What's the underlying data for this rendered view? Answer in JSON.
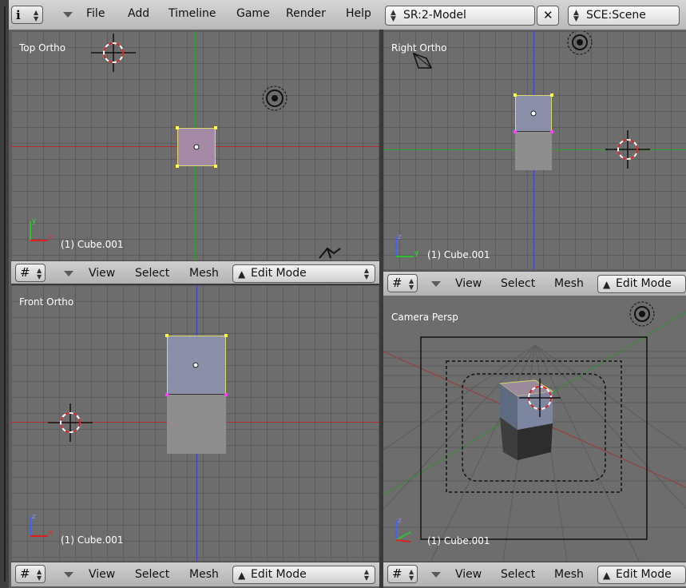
{
  "menubar": {
    "items": [
      "File",
      "Add",
      "Timeline",
      "Game",
      "Render",
      "Help"
    ],
    "screen_field": "SR:2-Model",
    "scene_field": "SCE:Scene",
    "close_glyph": "✕",
    "info_glyph": "i"
  },
  "viewports": {
    "top": {
      "label": "Top Ortho",
      "object": "(1) Cube.001"
    },
    "right": {
      "label": "Right Ortho",
      "object": "(1) Cube.001"
    },
    "front": {
      "label": "Front Ortho",
      "object": "(1) Cube.001"
    },
    "camera": {
      "label": "Camera Persp",
      "object": "(1) Cube.001"
    }
  },
  "viewport_header": {
    "view": "View",
    "select": "Select",
    "mesh": "Mesh",
    "mode": "Edit Mode"
  },
  "icons": {
    "editor_type": "grid-icon",
    "mode": "edit-mode-icon",
    "cursor": "3d-cursor-icon",
    "lamp": "lamp-icon",
    "camera": "camera-icon"
  },
  "colors": {
    "x_axis": "#b03030",
    "y_axis": "#30a030",
    "z_axis": "#4040c0",
    "selected_face": "#a48aa4",
    "vertex": "#ff40ff",
    "selected_vertex": "#ffff40"
  }
}
